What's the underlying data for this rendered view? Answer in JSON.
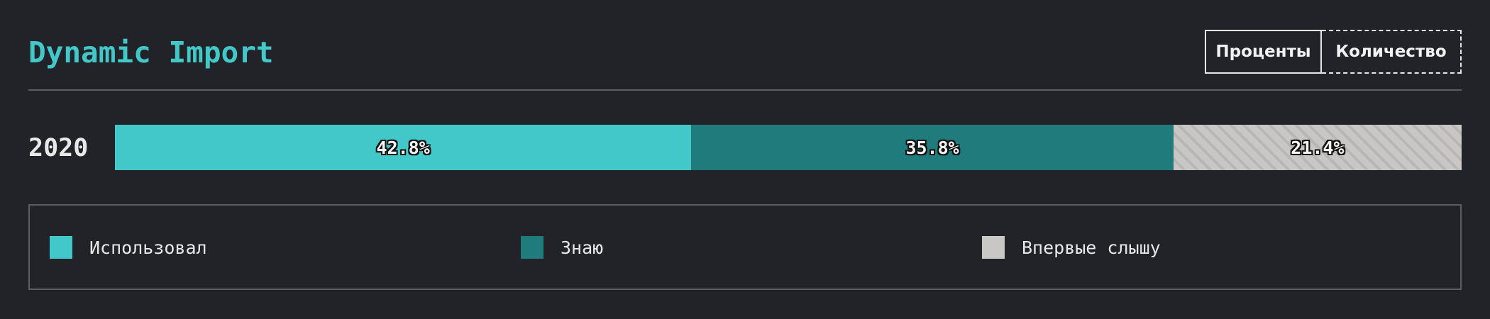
{
  "chart_data": {
    "type": "bar",
    "orientation": "horizontal-stacked-100",
    "title": "Dynamic Import",
    "categories": [
      "2020"
    ],
    "series": [
      {
        "name": "Использовал",
        "values": [
          42.8
        ],
        "label": "42.8%",
        "color": "#43c8c9",
        "pattern": "solid"
      },
      {
        "name": "Знаю",
        "values": [
          35.8
        ],
        "label": "35.8%",
        "color": "#1f7b7c",
        "pattern": "solid"
      },
      {
        "name": "Впервые слышу",
        "values": [
          21.4
        ],
        "label": "21.4%",
        "color": "#c8c7c5",
        "pattern": "diagonal-hatch"
      }
    ],
    "xlim": [
      0,
      100
    ],
    "grid": false,
    "legend_position": "bottom"
  },
  "controls": {
    "view_toggle": {
      "options": [
        "Проценты",
        "Количество"
      ],
      "selected": "Проценты"
    }
  },
  "colors": {
    "background": "#222328",
    "accent": "#43c8c9",
    "divider": "#5c5d62"
  }
}
